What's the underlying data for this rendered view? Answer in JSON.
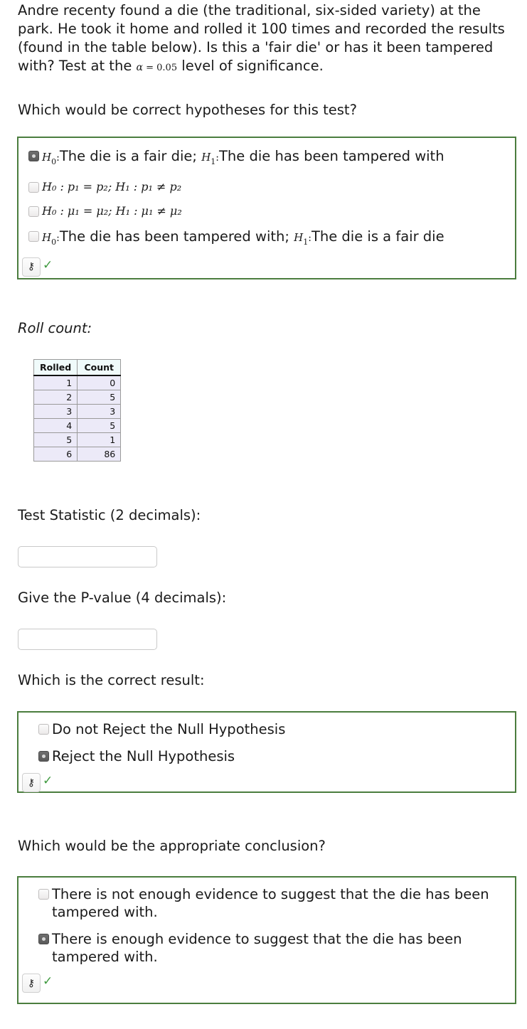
{
  "problem": {
    "text_part1": "Andre recenty found a die (the traditional, six-sided variety) at the park. He took it home and rolled it 100 times and recorded the results (found in the table below). Is this a 'fair die' or has it been tampered with? Test at the ",
    "alpha_symbol": "α",
    "alpha_equals": " = ",
    "alpha_value": "0.05",
    "text_part2": " level of significance."
  },
  "hypotheses_question": {
    "prompt": "Which would be correct hypotheses for this test?",
    "options": [
      {
        "selected": true,
        "type": "rich",
        "h0_label": "H",
        "h0_sub": "0",
        "h0_colon": ":",
        "h0_text": "The die is a fair die; ",
        "h1_label": "H",
        "h1_sub": "1",
        "h1_colon": ":",
        "h1_text": "The die has been tampered with"
      },
      {
        "selected": false,
        "type": "math",
        "math": "H₀ : p₁ = p₂;  H₁ : p₁ ≠ p₂"
      },
      {
        "selected": false,
        "type": "math",
        "math": "H₀ : μ₁ = μ₂;  H₁ : μ₁ ≠ μ₂"
      },
      {
        "selected": false,
        "type": "rich",
        "h0_label": "H",
        "h0_sub": "0",
        "h0_colon": ":",
        "h0_text": "The die has been tampered with; ",
        "h1_label": "H",
        "h1_sub": "1",
        "h1_colon": ":",
        "h1_text": "The die is a fair die"
      }
    ],
    "key_icon": "key-icon",
    "key_glyph": "⚷",
    "check_glyph": "✓"
  },
  "roll_count": {
    "label": "Roll count:",
    "columns": [
      "Rolled",
      "Count"
    ],
    "rows": [
      [
        "1",
        "0"
      ],
      [
        "2",
        "5"
      ],
      [
        "3",
        "3"
      ],
      [
        "4",
        "5"
      ],
      [
        "5",
        "1"
      ],
      [
        "6",
        "86"
      ]
    ]
  },
  "test_statistic": {
    "prompt": "Test Statistic (2 decimals):",
    "value": "",
    "placeholder": ""
  },
  "p_value": {
    "prompt": "Give the P-value (4 decimals):",
    "value": "",
    "placeholder": ""
  },
  "result_question": {
    "prompt": "Which is the correct result:",
    "options": [
      {
        "selected": false,
        "text": "Do not Reject the Null Hypothesis"
      },
      {
        "selected": true,
        "text": "Reject the Null Hypothesis"
      }
    ],
    "key_glyph": "⚷",
    "check_glyph": "✓"
  },
  "conclusion_question": {
    "prompt": "Which would be the appropriate conclusion?",
    "options": [
      {
        "selected": false,
        "text": "There is not enough evidence to suggest that the die has been tampered with."
      },
      {
        "selected": true,
        "text": "There is enough evidence to suggest that the die has been tampered with."
      }
    ],
    "key_glyph": "⚷",
    "check_glyph": "✓"
  },
  "colors": {
    "box_border": "#4b7d3e",
    "check": "#3f9a3f",
    "table_header_bg": "#f0fbfb",
    "table_cell_bg": "#eceaf8",
    "text": "#1a1a1a"
  }
}
